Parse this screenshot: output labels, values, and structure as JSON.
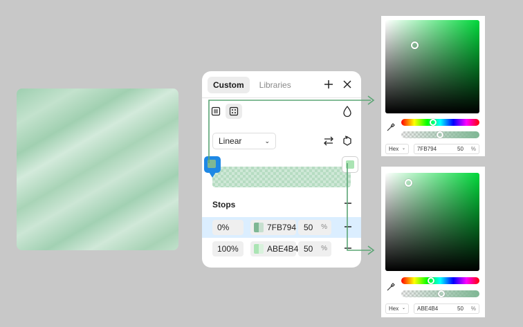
{
  "panel": {
    "tabs": [
      {
        "label": "Custom",
        "active": true
      },
      {
        "label": "Libraries",
        "active": false
      }
    ],
    "gradient_type": "Linear",
    "stops_title": "Stops",
    "stops": [
      {
        "position": "0%",
        "hex": "7FB794",
        "opacity": "50",
        "unit": "%",
        "color": "#7FB794",
        "selected": true
      },
      {
        "position": "100%",
        "hex": "ABE4B4",
        "opacity": "50",
        "unit": "%",
        "color": "#ABE4B4",
        "selected": false
      }
    ]
  },
  "pickers": [
    {
      "format": "Hex",
      "hex": "7FB794",
      "opacity": "50",
      "unit": "%",
      "color": "#7FB794"
    },
    {
      "format": "Hex",
      "hex": "ABE4B4",
      "opacity": "50",
      "unit": "%",
      "color": "#ABE4B4"
    }
  ],
  "colors": {
    "accent": "#1E88E5",
    "connector": "#5AA574",
    "selected_row": "#DBEEFF"
  },
  "icons": {
    "add": "plus-icon",
    "close": "close-icon",
    "fill_type_solid": "fill-solid-icon",
    "fill_type_image": "fill-image-icon",
    "opacity": "droplet-icon",
    "swap": "swap-arrows-icon",
    "rotate": "rotate-icon",
    "remove": "minus-icon",
    "eyedropper": "eyedropper-icon"
  }
}
